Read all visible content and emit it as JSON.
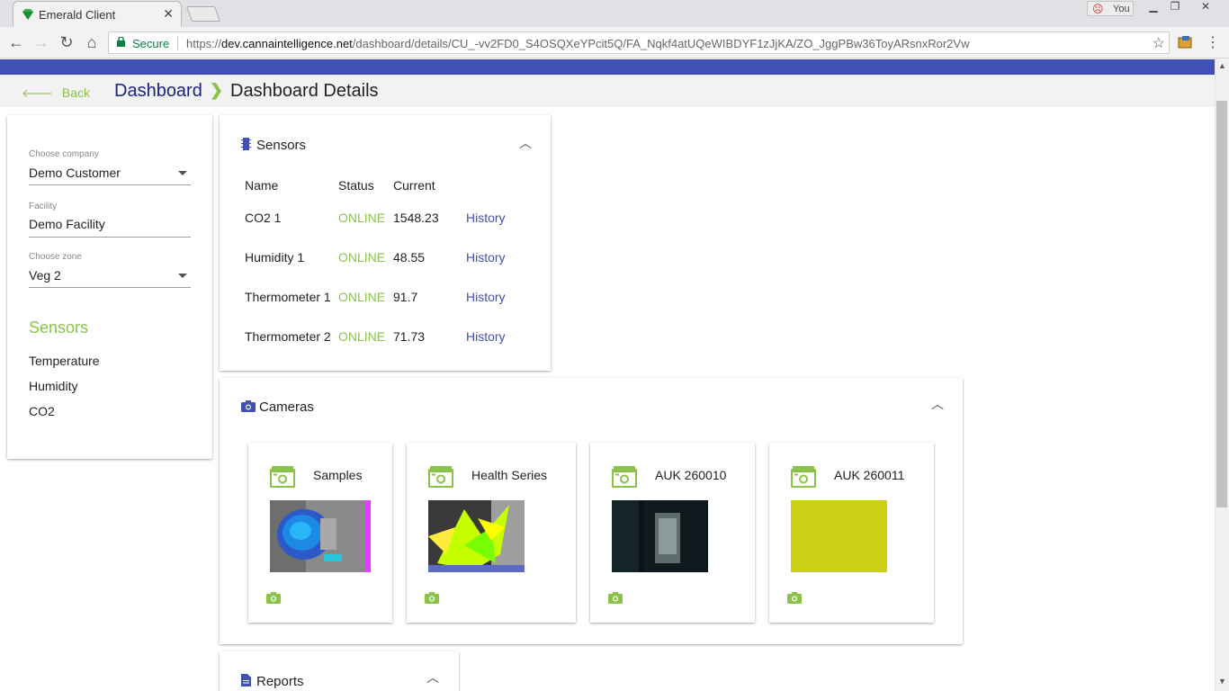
{
  "browser": {
    "tab_title": "Emerald Client",
    "tab_close": "✕",
    "profile_label": "You",
    "secure_label": "Secure",
    "url_scheme": "https://",
    "url_host": "dev.cannaintelligence.net",
    "url_path": "/dashboard/details/CU_-vv2FD0_S4OSQXeYPcit5Q/FA_Nqkf4atUQeWIBDYF1zJjKA/ZO_JggPBw36ToyARsnxRor2Vw"
  },
  "colors": {
    "app_bar": "#3f51b5",
    "accent_green": "#8bc34a",
    "link_blue": "#3f51b5",
    "breadcrumb_blue": "#1a237e"
  },
  "nav": {
    "back_label": "Back",
    "breadcrumb_root": "Dashboard",
    "breadcrumb_current": "Dashboard Details"
  },
  "filters": {
    "company_label": "Choose company",
    "company_value": "Demo Customer",
    "facility_label": "Facility",
    "facility_value": "Demo Facility",
    "zone_label": "Choose zone",
    "zone_value": "Veg 2",
    "sensors_heading": "Sensors",
    "sensor_types": [
      "Temperature",
      "Humidity",
      "CO2"
    ]
  },
  "sensors": {
    "title": "Sensors",
    "columns": [
      "Name",
      "Status",
      "Current"
    ],
    "rows": [
      {
        "name": "CO2 1",
        "status": "ONLINE",
        "current": "1548.23",
        "action": "History"
      },
      {
        "name": "Humidity 1",
        "status": "ONLINE",
        "current": "48.55",
        "action": "History"
      },
      {
        "name": "Thermometer 1",
        "status": "ONLINE",
        "current": "91.7",
        "action": "History"
      },
      {
        "name": "Thermometer 2",
        "status": "ONLINE",
        "current": "71.73",
        "action": "History"
      }
    ]
  },
  "cameras": {
    "title": "Cameras",
    "items": [
      {
        "name": "Samples"
      },
      {
        "name": "Health Series"
      },
      {
        "name": "AUK 260010"
      },
      {
        "name": "AUK 260011"
      }
    ]
  },
  "reports": {
    "title": "Reports"
  }
}
